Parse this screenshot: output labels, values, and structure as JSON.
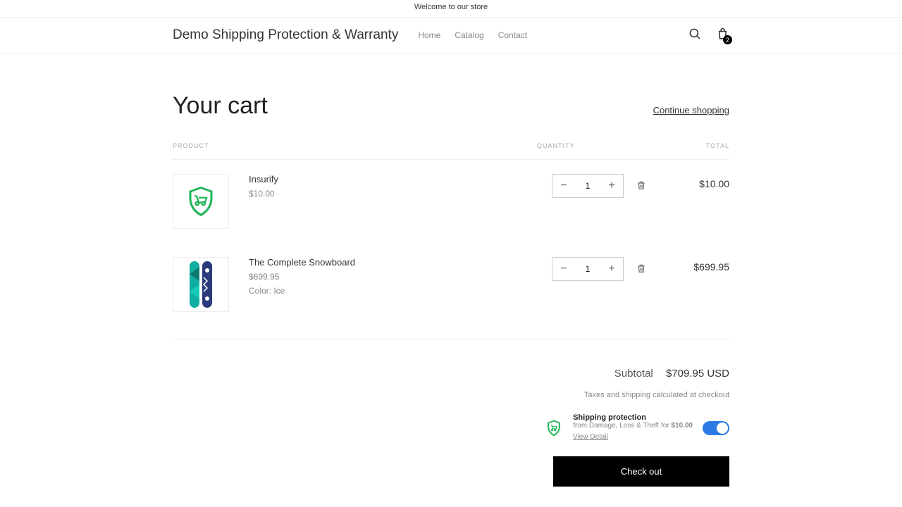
{
  "announcement": "Welcome to our store",
  "brand": "Demo Shipping Protection & Warranty",
  "nav": {
    "home": "Home",
    "catalog": "Catalog",
    "contact": "Contact"
  },
  "bag_count": "2",
  "page_title": "Your cart",
  "continue_link": "Continue shopping",
  "columns": {
    "product": "PRODUCT",
    "quantity": "QUANTITY",
    "total": "TOTAL"
  },
  "items": [
    {
      "name": "Insurify",
      "price": "$10.00",
      "variant": "",
      "qty": "1",
      "total": "$10.00"
    },
    {
      "name": "The Complete Snowboard",
      "price": "$699.95",
      "variant": "Color: Ice",
      "qty": "1",
      "total": "$699.95"
    }
  ],
  "subtotal_label": "Subtotal",
  "subtotal_value": "$709.95 USD",
  "tax_note": "Taxes and shipping calculated at checkout",
  "protection": {
    "title": "Shipping protection",
    "desc_prefix": "from Damage, Loss & Theft for ",
    "desc_price": "$10.00",
    "link": "View Detail"
  },
  "checkout": "Check out"
}
